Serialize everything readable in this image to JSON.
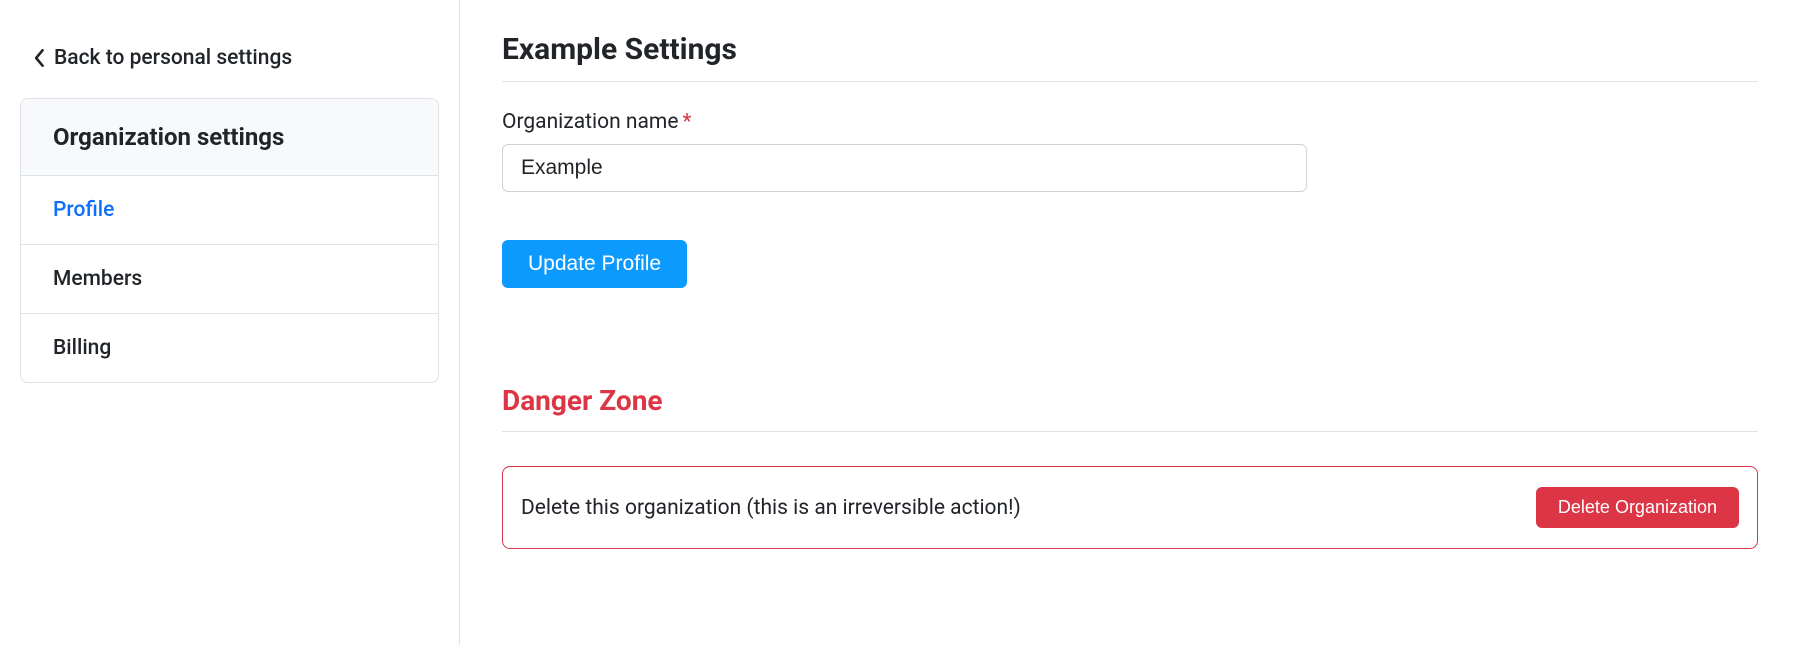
{
  "sidebar": {
    "back_label": "Back to personal settings",
    "header": "Organization settings",
    "items": [
      {
        "label": "Profile",
        "active": true
      },
      {
        "label": "Members",
        "active": false
      },
      {
        "label": "Billing",
        "active": false
      }
    ]
  },
  "main": {
    "title": "Example Settings",
    "org_name_label": "Organization name",
    "org_name_value": "Example",
    "update_button": "Update Profile"
  },
  "danger": {
    "title": "Danger Zone",
    "text": "Delete this organization (this is an irreversible action!)",
    "button": "Delete Organization"
  }
}
